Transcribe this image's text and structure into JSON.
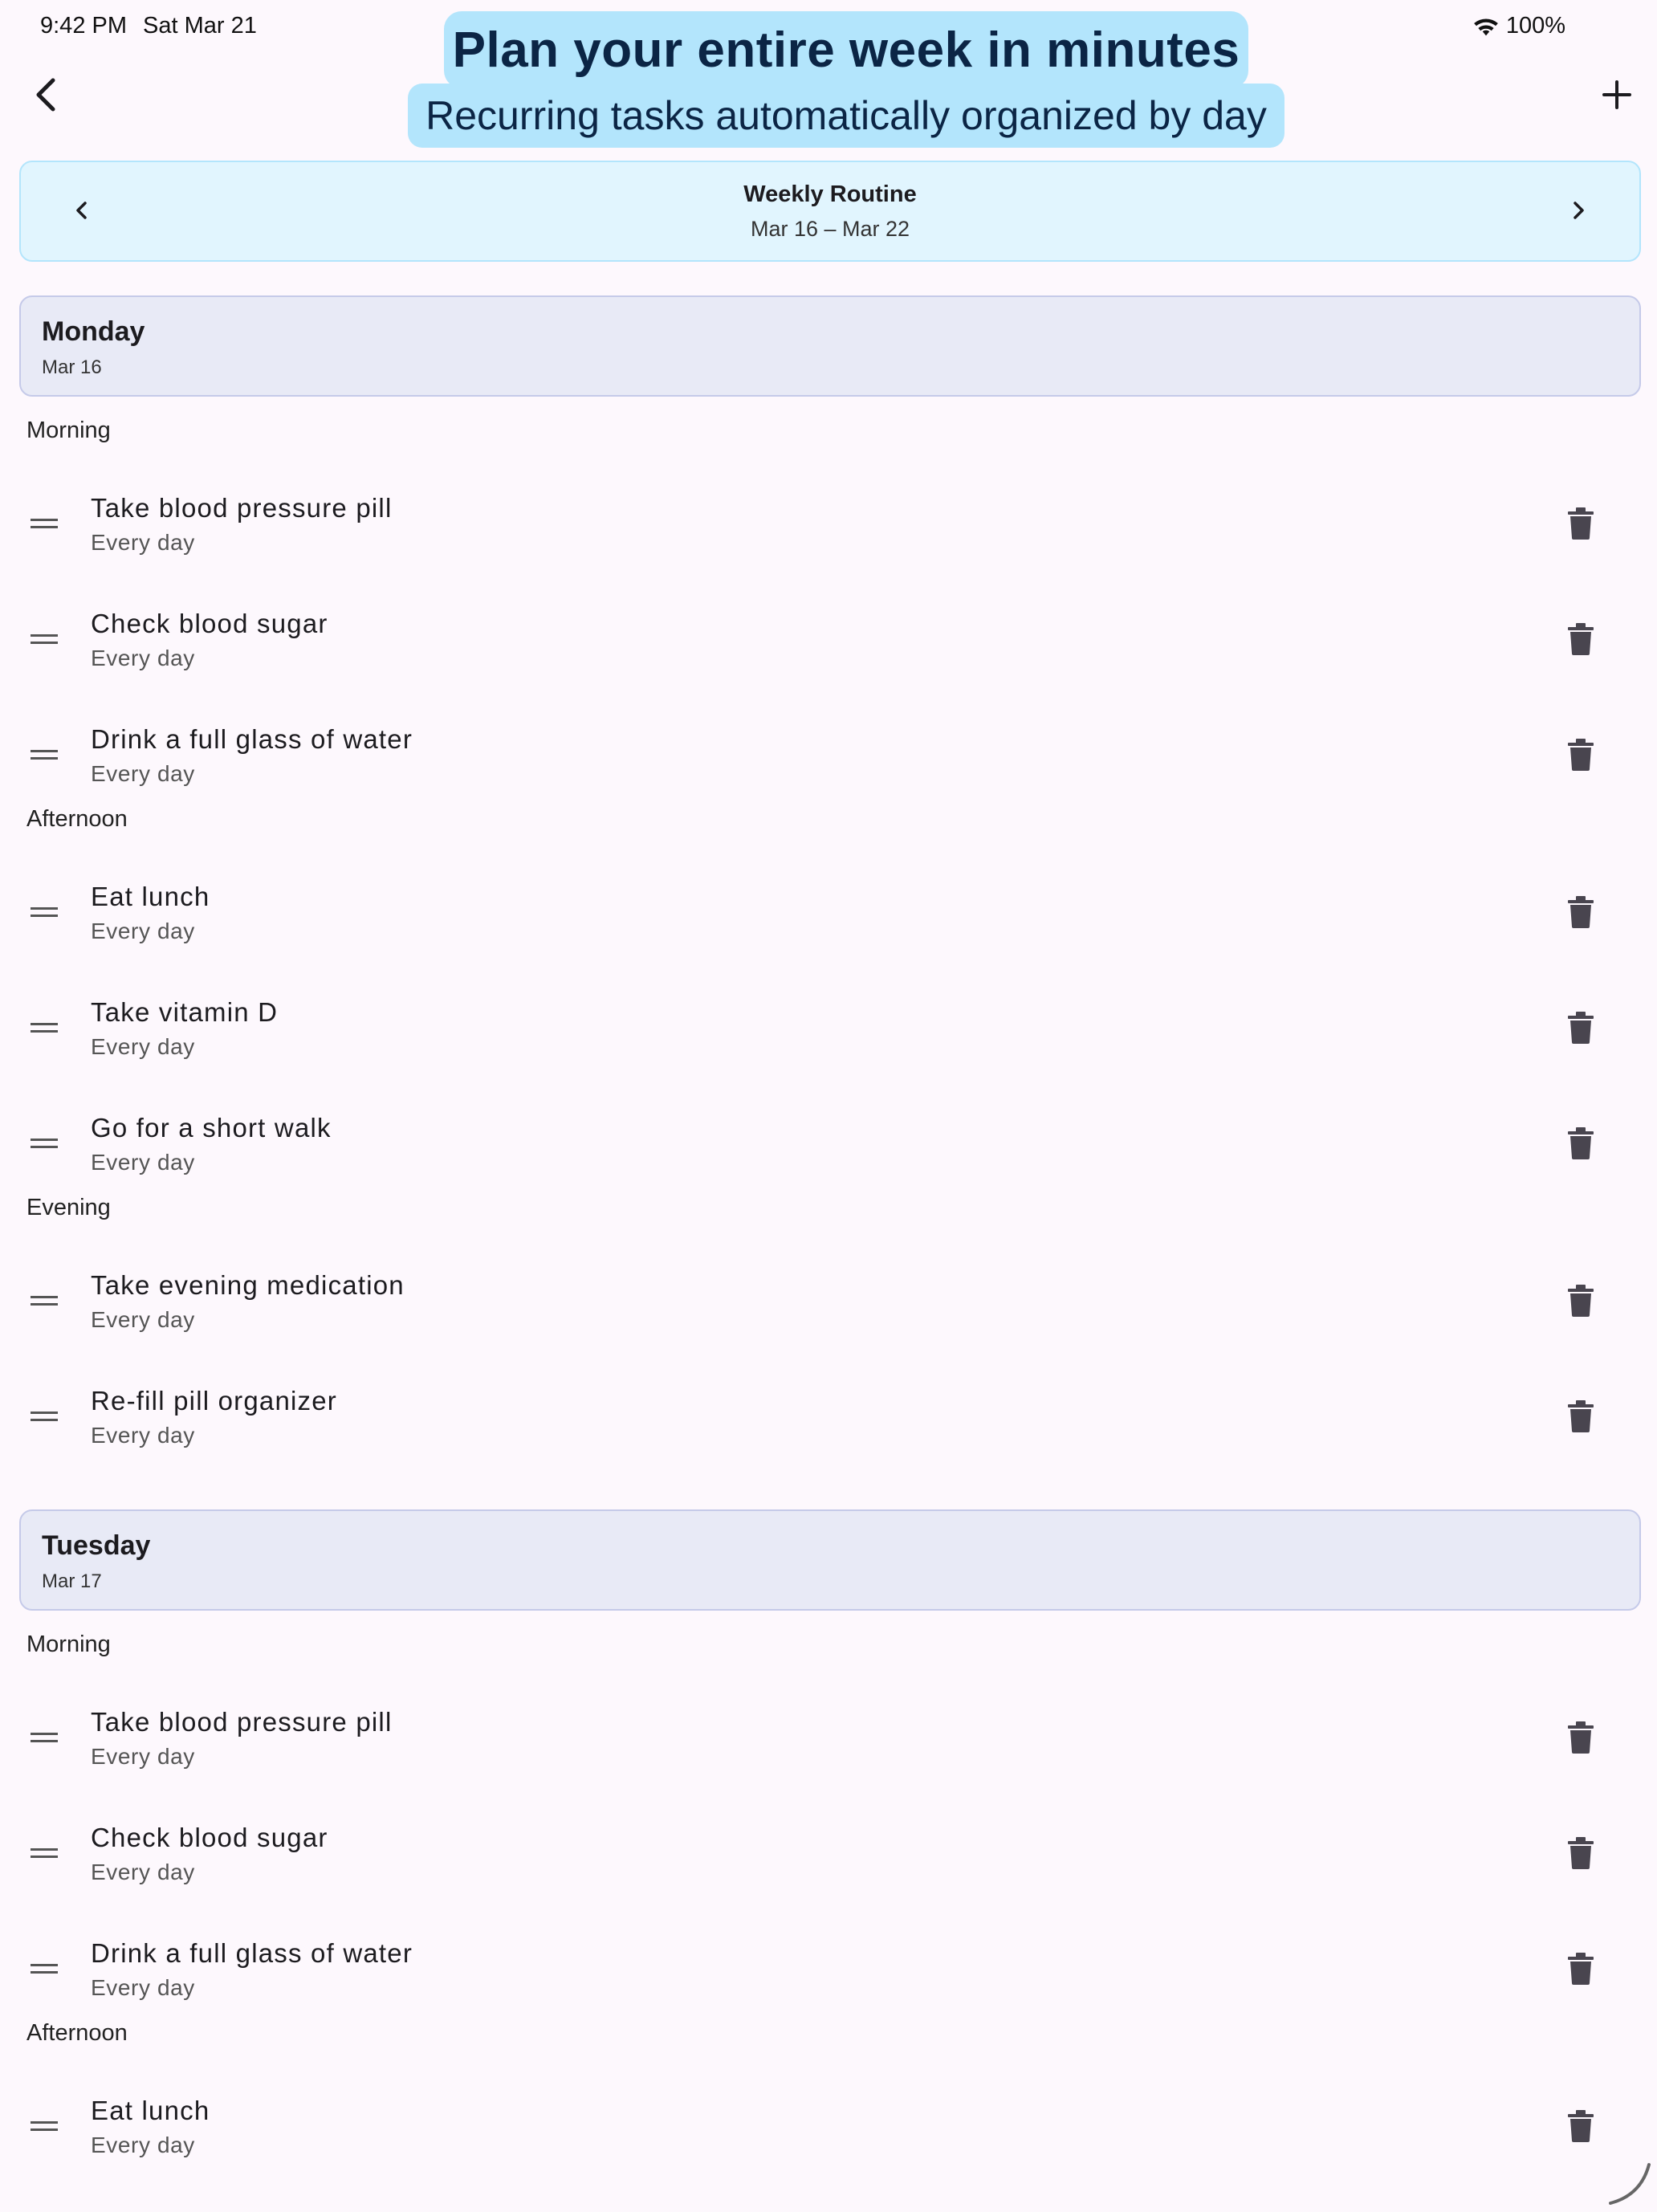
{
  "status_bar": {
    "time": "9:42 PM",
    "date": "Sat Mar 21",
    "battery": "100%"
  },
  "promo": {
    "title": "Plan your entire week in minutes",
    "subtitle": "Recurring tasks automatically organized by day"
  },
  "week": {
    "title": "Weekly Routine",
    "range": "Mar 16 – Mar 22"
  },
  "days": [
    {
      "name": "Monday",
      "date": "Mar 16",
      "sections": [
        {
          "label": "Morning",
          "tasks": [
            {
              "name": "Take blood pressure pill",
              "freq": "Every day"
            },
            {
              "name": "Check blood sugar",
              "freq": "Every day"
            },
            {
              "name": "Drink a full glass of water",
              "freq": "Every day"
            }
          ]
        },
        {
          "label": "Afternoon",
          "tasks": [
            {
              "name": "Eat lunch",
              "freq": "Every day"
            },
            {
              "name": "Take vitamin D",
              "freq": "Every day"
            },
            {
              "name": "Go for a short walk",
              "freq": "Every day"
            }
          ]
        },
        {
          "label": "Evening",
          "tasks": [
            {
              "name": "Take evening medication",
              "freq": "Every day"
            },
            {
              "name": "Re-fill pill organizer",
              "freq": "Every day"
            }
          ]
        }
      ]
    },
    {
      "name": "Tuesday",
      "date": "Mar 17",
      "sections": [
        {
          "label": "Morning",
          "tasks": [
            {
              "name": "Take blood pressure pill",
              "freq": "Every day"
            },
            {
              "name": "Check blood sugar",
              "freq": "Every day"
            },
            {
              "name": "Drink a full glass of water",
              "freq": "Every day"
            }
          ]
        },
        {
          "label": "Afternoon",
          "tasks": [
            {
              "name": "Eat lunch",
              "freq": "Every day"
            }
          ]
        }
      ]
    }
  ],
  "icons": {
    "back": "chevron-left-icon",
    "add": "plus-icon",
    "prev_week": "chevron-left-icon",
    "next_week": "chevron-right-icon",
    "drag": "drag-handle-icon",
    "delete": "trash-icon",
    "wifi": "wifi-icon"
  },
  "colors": {
    "promo_bg": "#b3e5fc",
    "week_card_bg": "#e1f5fe",
    "day_header_bg": "#e8eaf6",
    "page_bg": "#fdf8fd"
  }
}
